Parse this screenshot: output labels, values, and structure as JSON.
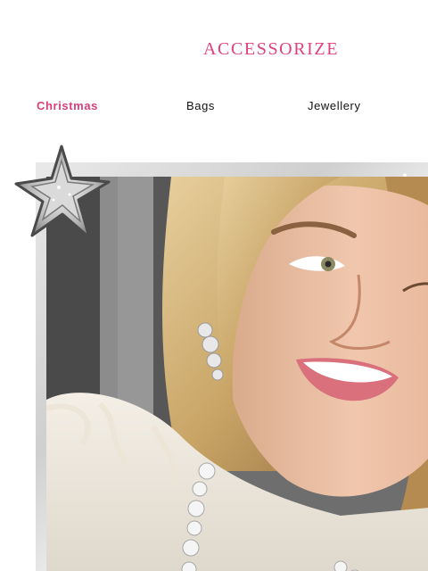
{
  "brand": {
    "name": "ACCESSORIZE",
    "color": "#e0407e"
  },
  "nav": {
    "items": [
      {
        "label": "Christmas",
        "active": true
      },
      {
        "label": "Bags",
        "active": false
      },
      {
        "label": "Jewellery",
        "active": false
      }
    ]
  },
  "hero": {
    "image_subject": "woman-smiling-wearing-crystal-jewellery",
    "decoration": "silver-glitter-star"
  }
}
